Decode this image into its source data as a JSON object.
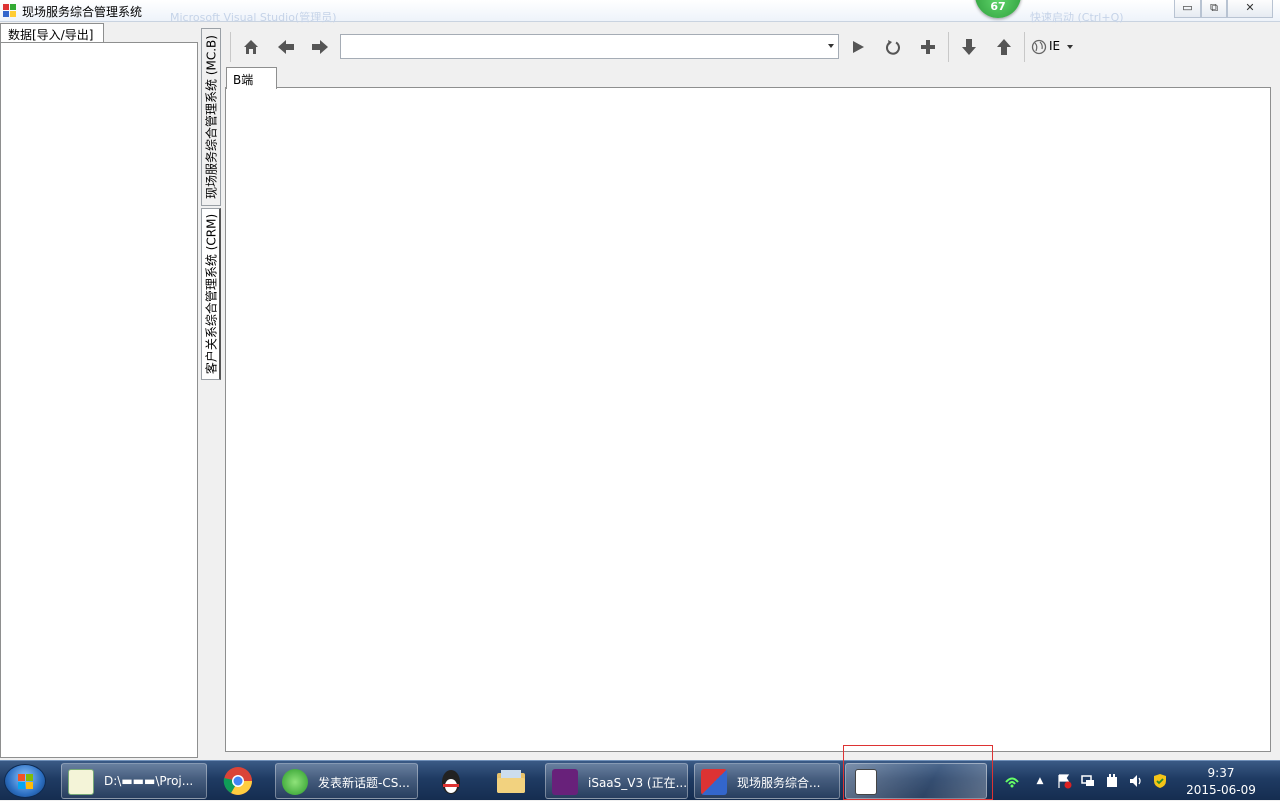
{
  "window": {
    "title": "现场服务综合管理系统",
    "ghost_title_1": "Microsoft Visual Studio(管理员)",
    "ghost_title_2": "快速启动 (Ctrl+Q)",
    "badge_count": "67",
    "controls": {
      "minimize": "▭",
      "restore": "⧉",
      "close": "✕"
    }
  },
  "left_panel": {
    "tab_label": "数据[导入/导出]"
  },
  "vertical_tabs": [
    {
      "label": "现场服务综合管理系统 (MC.B)",
      "active": false
    },
    {
      "label": "客户关系综合管理系统 (CRM)",
      "active": true
    }
  ],
  "toolbar": {
    "home_icon": "home-icon",
    "back_icon": "back-arrow-icon",
    "forward_icon": "forward-arrow-icon",
    "url_value": "",
    "go_icon": "play-icon",
    "refresh_icon": "refresh-icon",
    "add_icon": "plus-icon",
    "down_icon": "arrow-down-icon",
    "up_icon": "arrow-up-icon",
    "browser_label": "IE"
  },
  "content": {
    "tab_label": "B端"
  },
  "taskbar": {
    "items": [
      {
        "label": "D:\\▬▬▬\\Proj...",
        "icon": "notepad-icon"
      },
      {
        "label": "",
        "icon": "chrome-icon"
      },
      {
        "label": "发表新话题-CS...",
        "icon": "browser-e-icon"
      },
      {
        "label": "",
        "icon": "qq-icon"
      },
      {
        "label": "",
        "icon": "folder-icon"
      },
      {
        "label": "iSaaS_V3 (正在...",
        "icon": "visual-studio-icon"
      },
      {
        "label": "现场服务综合...",
        "icon": "app-window-icon"
      },
      {
        "label": "",
        "icon": "document-icon"
      }
    ],
    "time": "9:37",
    "date": "2015-06-09"
  },
  "colors": {
    "accent": "#2e9d3c",
    "taskbar": "#1f3b63"
  }
}
